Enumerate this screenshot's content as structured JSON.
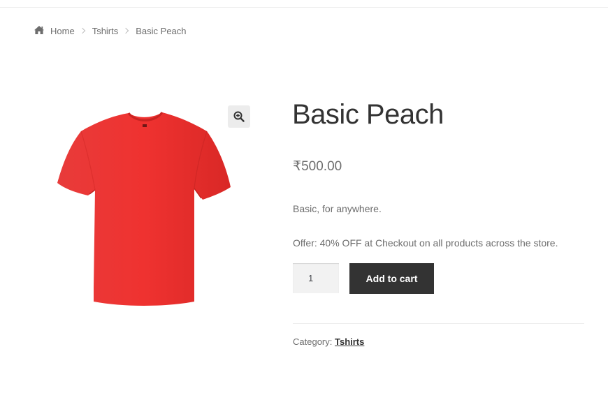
{
  "breadcrumb": {
    "home_icon": "home-icon",
    "separator_icon": "chevron-right-icon",
    "items": [
      "Home",
      "Tshirts",
      "Basic Peach"
    ]
  },
  "gallery": {
    "image": "red-tshirt-image",
    "zoom_icon": "zoom-in-icon"
  },
  "product": {
    "title": "Basic Peach",
    "price": "₹500.00",
    "short_description": "Basic, for anywhere.",
    "offer": "Offer: 40% OFF at Checkout on all products across the store.",
    "quantity": "1",
    "add_to_cart_label": "Add to cart",
    "category_label": "Category: ",
    "category": "Tshirts"
  },
  "colors": {
    "tshirt": "#e8312f",
    "button_bg": "#333333",
    "text": "#6d6d6d",
    "title": "#333333"
  }
}
